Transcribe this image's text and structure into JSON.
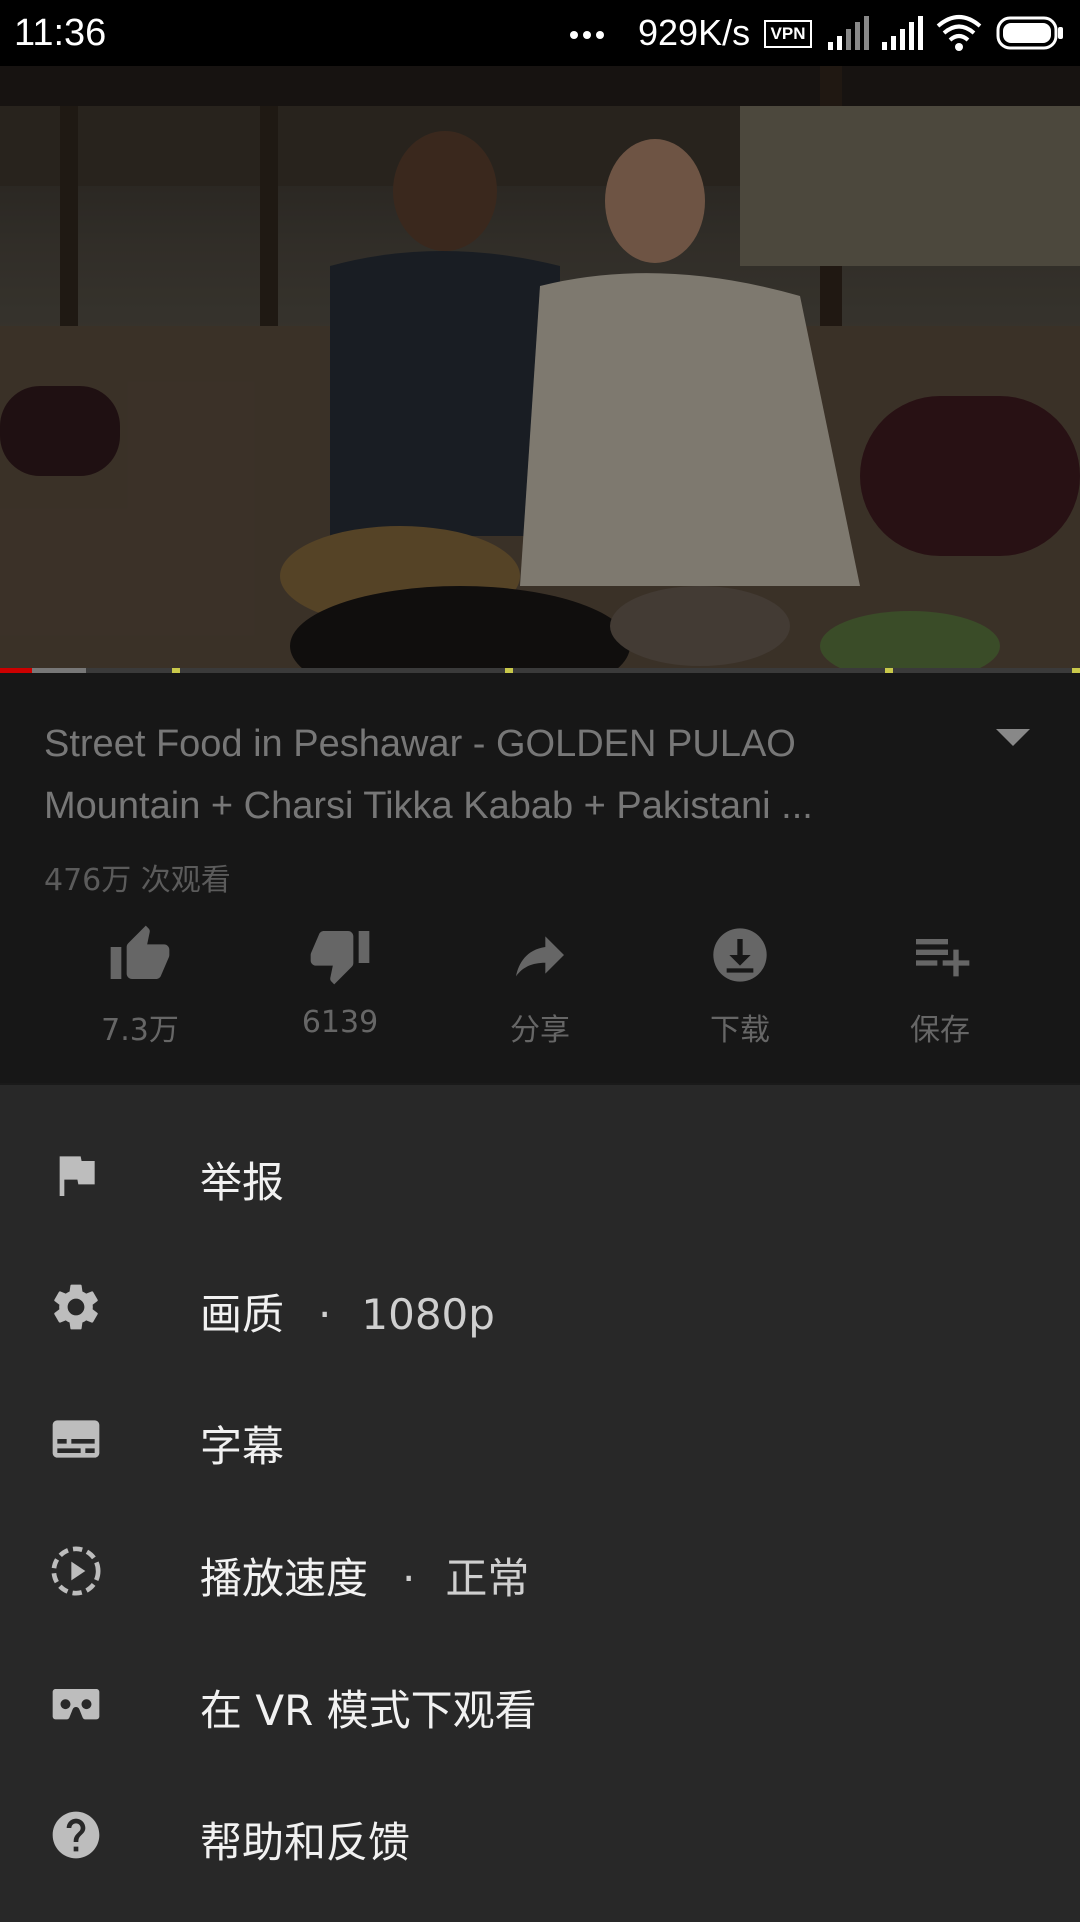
{
  "status_bar": {
    "time": "11:36",
    "network_speed": "929K/s",
    "vpn_label": "VPN",
    "icons": [
      "more-dots-icon",
      "vpn-icon",
      "signal-icon",
      "signal-icon",
      "wifi-icon",
      "battery-icon"
    ]
  },
  "video": {
    "progress_played_fraction": 0.03,
    "buffered_fraction": 0.08
  },
  "info": {
    "title": "Street Food in Peshawar - GOLDEN PULAO Mountain + Charsi Tikka Kabab + Pakistani ...",
    "views": "476万 次观看",
    "actions": [
      {
        "label": "7.3万",
        "icon": "thumb-up-icon"
      },
      {
        "label": "6139",
        "icon": "thumb-down-icon"
      },
      {
        "label": "分享",
        "icon": "share-icon"
      },
      {
        "label": "下载",
        "icon": "download-icon"
      },
      {
        "label": "保存",
        "icon": "playlist-add-icon"
      }
    ]
  },
  "menu": {
    "items": [
      {
        "label": "举报",
        "icon": "flag-icon"
      },
      {
        "label": "画质",
        "separator": "·",
        "value": "1080p",
        "icon": "gear-icon"
      },
      {
        "label": "字幕",
        "icon": "subtitles-icon"
      },
      {
        "label": "播放速度",
        "separator": "·",
        "value": "正常",
        "icon": "playback-speed-icon"
      },
      {
        "label": "在 VR 模式下观看",
        "icon": "vr-headset-icon"
      },
      {
        "label": "帮助和反馈",
        "icon": "help-icon"
      }
    ]
  },
  "colors": {
    "progress_played": "#cc0000",
    "sheet_bg": "#282828",
    "info_bg": "#171717"
  }
}
